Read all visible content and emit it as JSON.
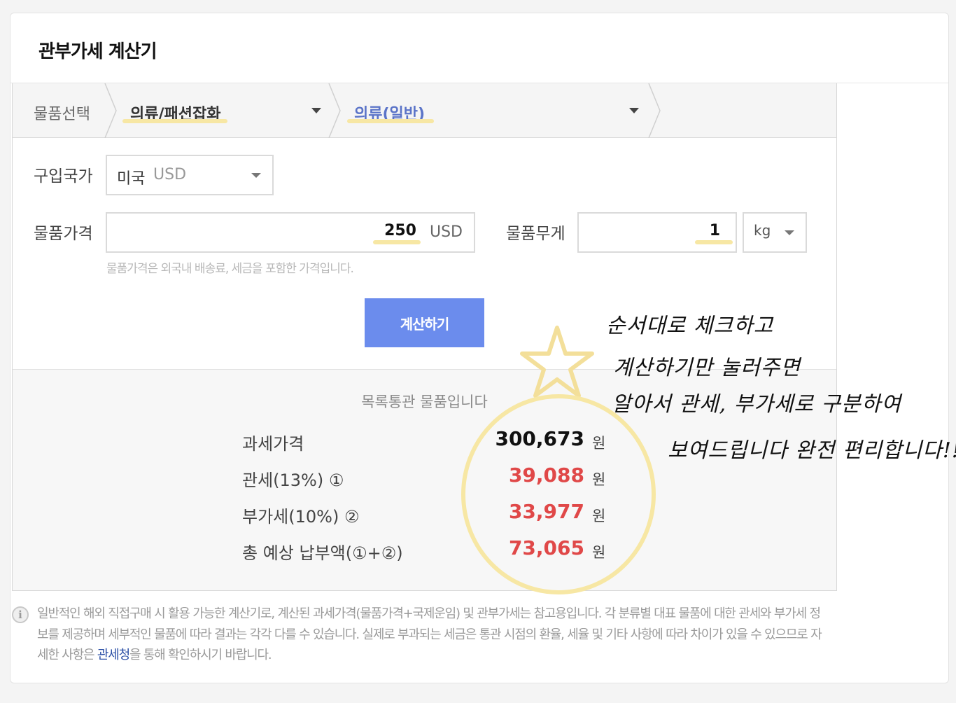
{
  "title": "관부가세 계산기",
  "category": {
    "label": "물품선택",
    "level1": "의류/패션잡화",
    "level2": "의류(일반)"
  },
  "form": {
    "country_label": "구입국가",
    "country_value": "미국",
    "country_currency": "USD",
    "price_label": "물품가격",
    "price_value": "250",
    "price_unit": "USD",
    "weight_label": "물품무게",
    "weight_value": "1",
    "weight_unit": "kg",
    "hint": "물품가격은 외국내 배송료, 세금을 포함한 가격입니다.",
    "submit_label": "계산하기"
  },
  "result": {
    "title": "목록통관 물품입니다",
    "unit": "원",
    "rows": [
      {
        "label": "과세가격",
        "value": "300,673"
      },
      {
        "label": "관세(13%) ①",
        "value": "39,088"
      },
      {
        "label": "부가세(10%) ②",
        "value": "33,977"
      },
      {
        "label": "총 예상 납부액(①+②)",
        "value": "73,065"
      }
    ]
  },
  "notice": {
    "text_before": "일반적인 해외 직접구매 시 활용 가능한 계산기로, 계산된 과세가격(물품가격+국제운임) 및 관부가세는 참고용입니다. 각 분류별 대표 물품에 대한 관세와 부가세 정보를 제공하며 세부적인 물품에 따라 결과는 각각 다를 수 있습니다. 실제로 부과되는 세금은 통관 시점의 환율, 세율 및 기타 사항에 따라 차이가 있을 수 있으므로 자세한 사항은 ",
    "link": "관세청",
    "text_after": "을 통해 확인하시기 바랍니다."
  },
  "annotation": {
    "lines": [
      "순서대로 체크하고",
      "계산하기만 눌러주면",
      "알아서 관세, 부가세로 구분하여",
      "보여드립니다 완전 편리합니다!!"
    ]
  },
  "colors": {
    "accent_button": "#6b8ced",
    "value_red": "#e04848",
    "highlight_yellow": "#f7e7a4",
    "link_blue": "#2b4fa6"
  }
}
